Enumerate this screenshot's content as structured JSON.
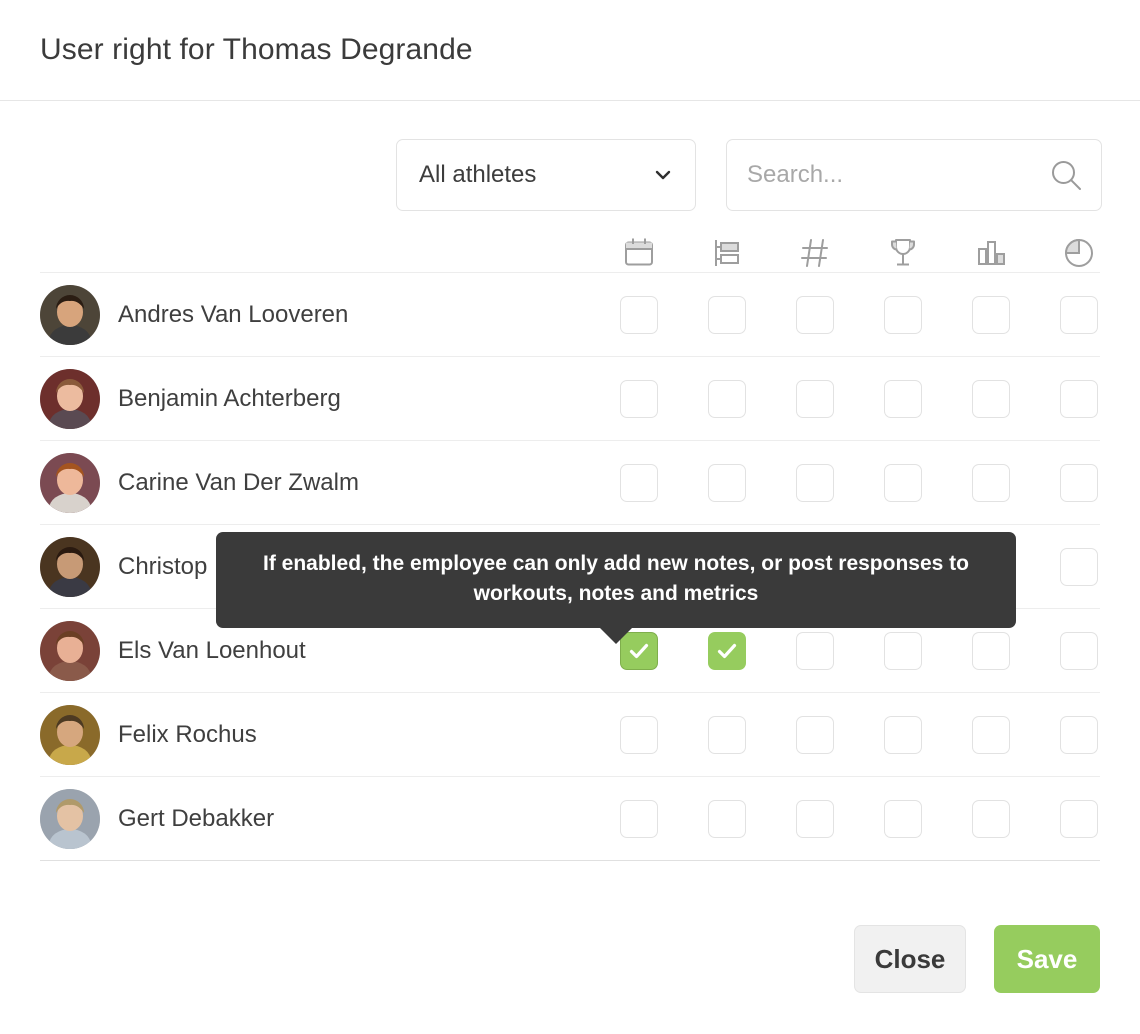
{
  "header": {
    "title": "User right for Thomas Degrande"
  },
  "toolbar": {
    "filter": {
      "selected": "All athletes",
      "icon": "chevron-down-icon"
    },
    "search": {
      "value": "",
      "placeholder": "Search...",
      "icon": "search-icon"
    }
  },
  "table": {
    "columns": [
      {
        "key": "calendar",
        "icon": "calendar-icon"
      },
      {
        "key": "tasks",
        "icon": "gantt-bars-icon"
      },
      {
        "key": "numbers",
        "icon": "hashtag-icon"
      },
      {
        "key": "goals",
        "icon": "trophy-icon"
      },
      {
        "key": "stats",
        "icon": "bar-chart-icon"
      },
      {
        "key": "reports",
        "icon": "pie-chart-icon"
      }
    ],
    "rows": [
      {
        "name": "Andres Van Looveren",
        "checks": [
          false,
          false,
          false,
          false,
          false,
          false
        ]
      },
      {
        "name": "Benjamin Achterberg",
        "checks": [
          false,
          false,
          false,
          false,
          false,
          false
        ]
      },
      {
        "name": "Carine Van Der Zwalm",
        "checks": [
          false,
          false,
          false,
          false,
          false,
          false
        ]
      },
      {
        "name": "Christop",
        "checks": [
          false,
          false,
          false,
          false,
          false,
          false
        ]
      },
      {
        "name": "Els Van Loenhout",
        "checks": [
          true,
          true,
          false,
          false,
          false,
          false
        ]
      },
      {
        "name": "Felix Rochus",
        "checks": [
          false,
          false,
          false,
          false,
          false,
          false
        ]
      },
      {
        "name": "Gert Debakker",
        "checks": [
          false,
          false,
          false,
          false,
          false,
          false
        ]
      }
    ]
  },
  "tooltip": {
    "text": "If enabled, the employee can only add new notes, or post responses to workouts, notes and metrics"
  },
  "footer": {
    "close_label": "Close",
    "save_label": "Save"
  },
  "colors": {
    "accent_green": "#96cc5e",
    "tooltip_bg": "#3a3a3a",
    "text_primary": "#3b3b3b",
    "border": "#e6e6e6"
  }
}
